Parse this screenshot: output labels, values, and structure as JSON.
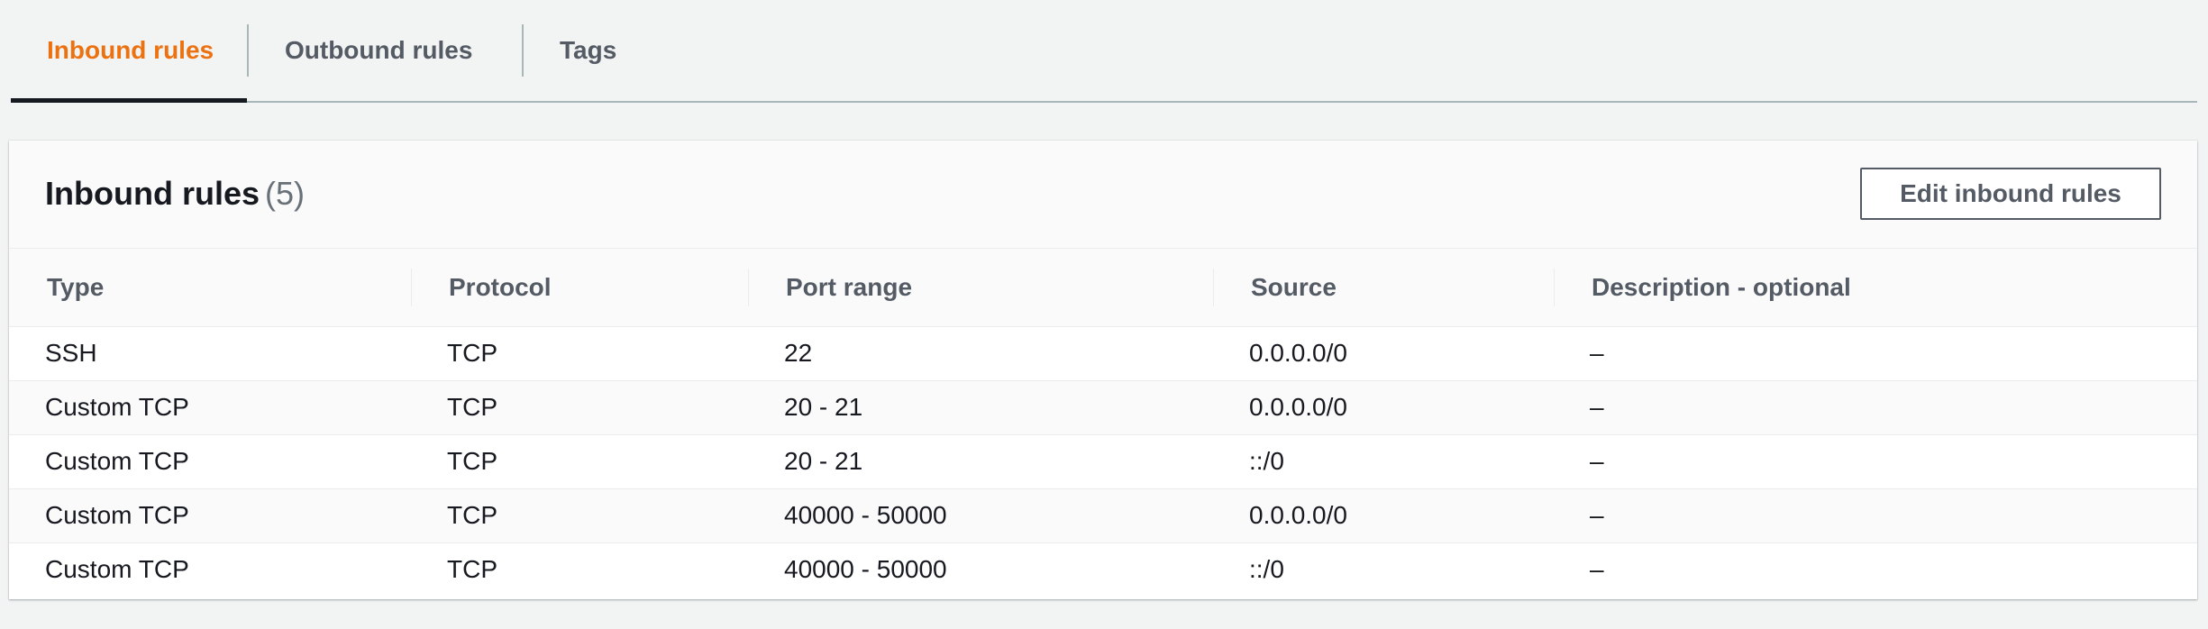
{
  "tabs": [
    {
      "label": "Inbound rules",
      "active": true
    },
    {
      "label": "Outbound rules",
      "active": false
    },
    {
      "label": "Tags",
      "active": false
    }
  ],
  "panel": {
    "title": "Inbound rules",
    "count": "(5)",
    "edit_button_label": "Edit inbound rules"
  },
  "table": {
    "columns": [
      "Type",
      "Protocol",
      "Port range",
      "Source",
      "Description - optional"
    ],
    "rows": [
      [
        "SSH",
        "TCP",
        "22",
        "0.0.0.0/0",
        "–"
      ],
      [
        "Custom TCP",
        "TCP",
        "20 - 21",
        "0.0.0.0/0",
        "–"
      ],
      [
        "Custom TCP",
        "TCP",
        "20 - 21",
        "::/0",
        "–"
      ],
      [
        "Custom TCP",
        "TCP",
        "40000 - 50000",
        "0.0.0.0/0",
        "–"
      ],
      [
        "Custom TCP",
        "TCP",
        "40000 - 50000",
        "::/0",
        "–"
      ]
    ]
  },
  "colors": {
    "active_tab": "#ec7211",
    "text": "#16191f",
    "muted_text": "#545b64",
    "background": "#f2f3f3"
  }
}
